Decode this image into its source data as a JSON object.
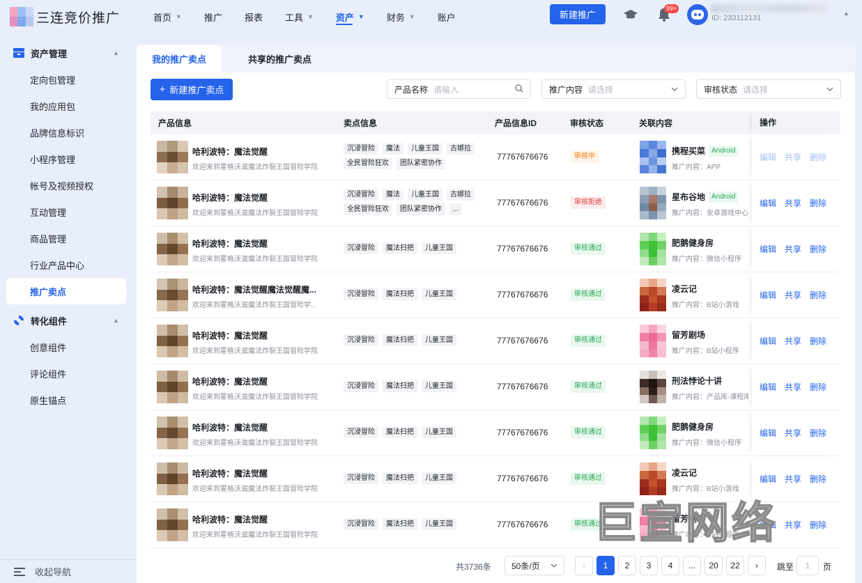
{
  "brand": {
    "name": "三连竞价推广"
  },
  "nav": {
    "items": [
      {
        "label": "首页",
        "caret": true,
        "active": false
      },
      {
        "label": "推广",
        "caret": false,
        "active": false
      },
      {
        "label": "报表",
        "caret": false,
        "active": false
      },
      {
        "label": "工具",
        "caret": true,
        "active": false
      },
      {
        "label": "资产",
        "caret": true,
        "active": true
      },
      {
        "label": "财务",
        "caret": true,
        "active": false
      },
      {
        "label": "账户",
        "caret": false,
        "active": false
      }
    ],
    "new_button": "新建推广",
    "badge": "99+",
    "user_id": "ID: 233112131"
  },
  "sidebar": {
    "group1": "资产管理",
    "group1_items": [
      "定向包管理",
      "我的应用包",
      "品牌信息标识",
      "小程序管理",
      "帐号及视频授权",
      "互动管理",
      "商品管理",
      "行业产品中心",
      "推广卖点"
    ],
    "active_item": "推广卖点",
    "group2": "转化组件",
    "group2_items": [
      "创意组件",
      "评论组件",
      "原生锚点"
    ],
    "collapse": "收起导航"
  },
  "tabs": [
    "我的推广卖点",
    "共享的推广卖点"
  ],
  "toolbar": {
    "add_button": "新建推广卖点",
    "filters": [
      {
        "label": "产品名称",
        "placeholder": "请输入",
        "icon": "search-icon"
      },
      {
        "label": "推广内容",
        "placeholder": "请选择",
        "icon": "chevron-down-icon"
      },
      {
        "label": "审核状态",
        "placeholder": "请选择",
        "icon": "chevron-down-icon"
      }
    ]
  },
  "table": {
    "headers": [
      "产品信息",
      "卖点信息",
      "产品信息ID",
      "审核状态",
      "关联内容",
      "操作"
    ],
    "rows": [
      {
        "title": "哈利波特：魔法觉醒",
        "sub": "欢迎来到霍格沃滋魔法炸裂王国冒险学院",
        "tags": [
          "沉浸冒险",
          "魔法",
          "儿童王国",
          "古娜拉",
          "全民冒险狂欢",
          "团队紧密协作"
        ],
        "id": "77767676676",
        "status": "审核中",
        "status_type": "pend",
        "rel_title": "携程买菜",
        "rel_badge": "Android",
        "rel_sub": "推广内容：APP",
        "ops_disabled": true,
        "thumb": [
          "#c9b9a3",
          "#b09a80",
          "#d8cab6",
          "#8b6e52",
          "#6b4e32",
          "#9c7a58",
          "#e1d2c0",
          "#c7ad8e",
          "#d6c3ad"
        ],
        "rthumb": [
          "#7ea4e6",
          "#5b88de",
          "#9bb8ee",
          "#4a7bd8",
          "#86a9e9",
          "#3d6fd2",
          "#a9c2f0",
          "#6c93e0",
          "#b7cdf3",
          "#5a86dc",
          "#92b2eb",
          "#4677d6"
        ]
      },
      {
        "title": "哈利波特：魔法觉醒",
        "sub": "欢迎来到霍格沃滋魔法炸裂王国冒险学院",
        "tags": [
          "沉浸冒险",
          "魔法",
          "儿童王国",
          "古娜拉",
          "全民冒险狂欢",
          "团队紧密协作",
          "..."
        ],
        "id": "77767676676",
        "status": "审核拒绝",
        "status_type": "rej",
        "rel_title": "星布谷地",
        "rel_badge": "Android",
        "rel_sub": "推广内容：安卓游戏中心",
        "ops_disabled": false,
        "thumb": [
          "#d1c3b0",
          "#a48a6c",
          "#c8b49c",
          "#7c5e42",
          "#5f4229",
          "#8f6d4d",
          "#d9c8b3",
          "#bfa283",
          "#cfbaa2"
        ],
        "rthumb": [
          "#b7c4d2",
          "#9fb1c2",
          "#c9d3de",
          "#8ba0b5",
          "#a8786a",
          "#7e96ad",
          "#6f8ba3",
          "#8a5e4a",
          "#94a9bd",
          "#a9b9c9",
          "#7d93a9",
          "#b9c6d3"
        ]
      },
      {
        "title": "哈利波特：魔法觉醒",
        "sub": "欢迎来到霍格沃滋魔法炸裂王国冒险学院",
        "tags": [
          "沉浸冒险",
          "魔法扫把",
          "儿童王国"
        ],
        "id": "77767676676",
        "status": "审核通过",
        "status_type": "ok",
        "rel_title": "肥鹅健身房",
        "rel_badge": "",
        "rel_sub": "推广内容：微信小程序",
        "ops_disabled": false,
        "thumb": [
          "#cdbda8",
          "#a98e70",
          "#d3c1ab",
          "#826448",
          "#64472d",
          "#957352",
          "#ddcbb6",
          "#c3a688",
          "#d3bea6"
        ],
        "rthumb": [
          "#b3e6b0",
          "#7ed878",
          "#c6eec3",
          "#5fcc57",
          "#43c13a",
          "#6fd268",
          "#8fde89",
          "#3fbf36",
          "#a2e39d",
          "#c0ecbc",
          "#6cd164",
          "#b0e5ac"
        ]
      },
      {
        "title": "哈利波特：魔法觉醒魔法觉醒魔...",
        "sub": "欢迎来到霍格沃滋魔法炸裂王国冒险学...",
        "tags": [
          "沉浸冒险",
          "魔法扫把",
          "儿童王国"
        ],
        "id": "77767676676",
        "status": "审核通过",
        "status_type": "ok",
        "rel_title": "凌云记",
        "rel_badge": "",
        "rel_sub": "推广内容：B站小游戏",
        "ops_disabled": false,
        "thumb": [
          "#d3c5b2",
          "#ab9276",
          "#cbb79f",
          "#866a4e",
          "#684b31",
          "#977656",
          "#dccab5",
          "#c1a486",
          "#d1bca4"
        ],
        "rthumb": [
          "#f2c9b6",
          "#e8a58a",
          "#f5d4c3",
          "#c9683f",
          "#b9482a",
          "#d47a54",
          "#9d2e1e",
          "#c1532f",
          "#a8361f",
          "#8e2418",
          "#b23c24",
          "#982c1c"
        ]
      },
      {
        "title": "哈利波特：魔法觉醒",
        "sub": "欢迎来到霍格沃滋魔法炸裂王国冒险学院",
        "tags": [
          "沉浸冒险",
          "魔法扫把",
          "儿童王国"
        ],
        "id": "77767676676",
        "status": "审核通过",
        "status_type": "ok",
        "rel_title": "留芳剧场",
        "rel_badge": "",
        "rel_sub": "推广内容：B站小程序",
        "ops_disabled": false,
        "thumb": [
          "#cfbfaa",
          "#a78c6e",
          "#d0bea8",
          "#806246",
          "#62452b",
          "#937150",
          "#dbc9b4",
          "#c1a486",
          "#d2bda5"
        ],
        "rthumb": [
          "#f9c9d8",
          "#f4a5bf",
          "#fbd6e2",
          "#ef7fa3",
          "#ec6b95",
          "#f293b2",
          "#f7b7cc",
          "#ee779e",
          "#f9c4d5",
          "#f5adc4",
          "#ef86a8",
          "#f8bfd0"
        ]
      },
      {
        "title": "哈利波特：魔法觉醒",
        "sub": "欢迎来到霍格沃滋魔法炸裂王国冒险学院",
        "tags": [
          "沉浸冒险",
          "魔法扫把",
          "儿童王国"
        ],
        "id": "77767676676",
        "status": "审核通过",
        "status_type": "ok",
        "rel_title": "刑法悖论十讲",
        "rel_badge": "",
        "rel_sub": "推广内容：产品库-课程库",
        "ops_disabled": false,
        "thumb": [
          "#cdbca6",
          "#a58a6c",
          "#cfbca5",
          "#7e6045",
          "#604329",
          "#916f4f",
          "#dac8b3",
          "#bfa284",
          "#d0bba3"
        ],
        "rthumb": [
          "#e6e0dc",
          "#c8bfb9",
          "#ece7e3",
          "#3b2a26",
          "#1f1512",
          "#5a4640",
          "#8b6f66",
          "#2a1c18",
          "#a68e85",
          "#d3c8c2",
          "#6e5850",
          "#bfb2ab"
        ]
      },
      {
        "title": "哈利波特：魔法觉醒",
        "sub": "欢迎来到霍格沃滋魔法炸裂王国冒险学院",
        "tags": [
          "沉浸冒险",
          "魔法扫把",
          "儿童王国"
        ],
        "id": "77767676676",
        "status": "审核通过",
        "status_type": "ok",
        "rel_title": "肥鹅健身房",
        "rel_badge": "",
        "rel_sub": "推广内容：微信小程序",
        "ops_disabled": false,
        "thumb": [
          "#d0c1ad",
          "#a98f72",
          "#d2c0aa",
          "#83654a",
          "#654830",
          "#967454",
          "#dccab6",
          "#c2a588",
          "#d3bea7"
        ],
        "rthumb": [
          "#b3e6b0",
          "#7ed878",
          "#c6eec3",
          "#5fcc57",
          "#43c13a",
          "#6fd268",
          "#8fde89",
          "#3fbf36",
          "#a2e39d",
          "#c0ecbc",
          "#6cd164",
          "#b0e5ac"
        ]
      },
      {
        "title": "哈利波特：魔法觉醒",
        "sub": "欢迎来到霍格沃滋魔法炸裂王国冒险学院",
        "tags": [
          "沉浸冒险",
          "魔法扫把",
          "儿童王国"
        ],
        "id": "77767676676",
        "status": "审核通过",
        "status_type": "ok",
        "rel_title": "凌云记",
        "rel_badge": "",
        "rel_sub": "推广内容：B站小游戏",
        "ops_disabled": false,
        "thumb": [
          "#cebea9",
          "#a88d6f",
          "#cebba4",
          "#7f6147",
          "#61442a",
          "#927050",
          "#dac8b3",
          "#c0a385",
          "#d1bca4"
        ],
        "rthumb": [
          "#f2c9b6",
          "#e8a58a",
          "#f5d4c3",
          "#c9683f",
          "#b9482a",
          "#d47a54",
          "#9d2e1e",
          "#c1532f",
          "#a8361f",
          "#8e2418",
          "#b23c24",
          "#982c1c"
        ]
      },
      {
        "title": "哈利波特：魔法觉醒",
        "sub": "欢迎来到霍格沃滋魔法炸裂王国冒险学院",
        "tags": [
          "沉浸冒险",
          "魔法扫把",
          "儿童王国"
        ],
        "id": "77767676676",
        "status": "审核通过",
        "status_type": "ok",
        "rel_title": "留芳剧场",
        "rel_badge": "",
        "rel_sub": "推广内容：B站小程序",
        "ops_disabled": false,
        "thumb": [
          "#cfbfab",
          "#a98e70",
          "#d1bfa9",
          "#816347",
          "#63462c",
          "#947251",
          "#dbc9b5",
          "#c1a487",
          "#d2bda6"
        ],
        "rthumb": [
          "#f9c9d8",
          "#f4a5bf",
          "#fbd6e2",
          "#ef7fa3",
          "#ec6b95",
          "#f293b2",
          "#f7b7cc",
          "#ee779e",
          "#f9c4d5",
          "#f5adc4",
          "#ef86a8",
          "#f8bfd0"
        ]
      }
    ],
    "ops": [
      "编辑",
      "共享",
      "删除"
    ]
  },
  "pagination": {
    "total": "共3736条",
    "page_size": "50条/页",
    "pages": [
      "1",
      "2",
      "3",
      "4",
      "...",
      "20",
      "22"
    ],
    "current": "1",
    "jump_label": "跳至",
    "jump_value": "1",
    "page_suffix": "页"
  },
  "watermark": "巨宣网络",
  "colors": {
    "primary": "#2563eb",
    "bg": "#e8eefa",
    "danger": "#f54a45",
    "success": "#25a659",
    "warning": "#f77b14"
  }
}
